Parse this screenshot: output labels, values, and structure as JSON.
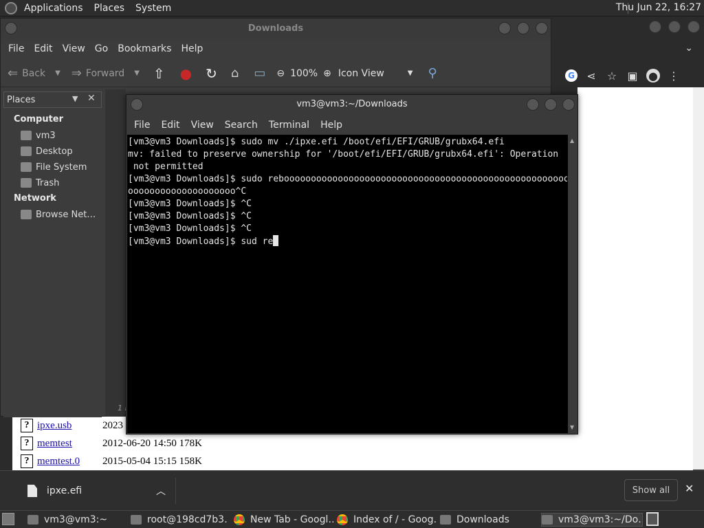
{
  "top_panel": {
    "menus": [
      "Applications",
      "Places",
      "System"
    ],
    "clock": "Thu Jun 22, 16:27"
  },
  "file_manager": {
    "title": "Downloads",
    "menu": [
      "File",
      "Edit",
      "View",
      "Go",
      "Bookmarks",
      "Help"
    ],
    "toolbar": {
      "back": "Back",
      "forward": "Forward",
      "zoom": "100%",
      "view_mode": "Icon View"
    },
    "sidebar": {
      "header": "Places",
      "sections": [
        {
          "title": "Computer",
          "items": [
            "vm3",
            "Desktop",
            "File System",
            "Trash"
          ]
        },
        {
          "title": "Network",
          "items": [
            "Browse Net…"
          ]
        }
      ]
    },
    "status_fragment": "1 i"
  },
  "terminal": {
    "title": "vm3@vm3:~/Downloads",
    "menu": [
      "File",
      "Edit",
      "View",
      "Search",
      "Terminal",
      "Help"
    ],
    "lines": [
      "[vm3@vm3 Downloads]$ sudo mv ./ipxe.efi /boot/efi/EFI/GRUB/grubx64.efi",
      "mv: failed to preserve ownership for '/boot/efi/EFI/GRUB/grubx64.efi': Operation",
      " not permitted",
      "[vm3@vm3 Downloads]$ sudo rebooooooooooooooooooooooooooooooooooooooooooooooooooooo",
      "oooooooooooooooooooo^C",
      "[vm3@vm3 Downloads]$ ^C",
      "[vm3@vm3 Downloads]$ ^C",
      "[vm3@vm3 Downloads]$ ^C",
      "[vm3@vm3 Downloads]$ sud re"
    ]
  },
  "browser_listing": {
    "rows": [
      {
        "name": "ipxe.usb",
        "info": "2023"
      },
      {
        "name": "memtest",
        "info": "2012-06-20 14:50 178K"
      },
      {
        "name": "memtest.0",
        "info": "2015-05-04 15:15 158K"
      }
    ]
  },
  "downloads_bar": {
    "file": "ipxe.efi",
    "show_all": "Show all"
  },
  "taskbar": {
    "tasks": [
      {
        "label": "vm3@vm3:~",
        "icon": "terminal-icon"
      },
      {
        "label": "root@198cd7b3…",
        "icon": "terminal-icon"
      },
      {
        "label": "New Tab - Googl…",
        "icon": "chrome-icon"
      },
      {
        "label": "Index of / - Goog…",
        "icon": "chrome-icon"
      },
      {
        "label": "Downloads",
        "icon": "folder-icon"
      },
      {
        "label": "vm3@vm3:~/Do…",
        "icon": "terminal-icon"
      }
    ]
  }
}
